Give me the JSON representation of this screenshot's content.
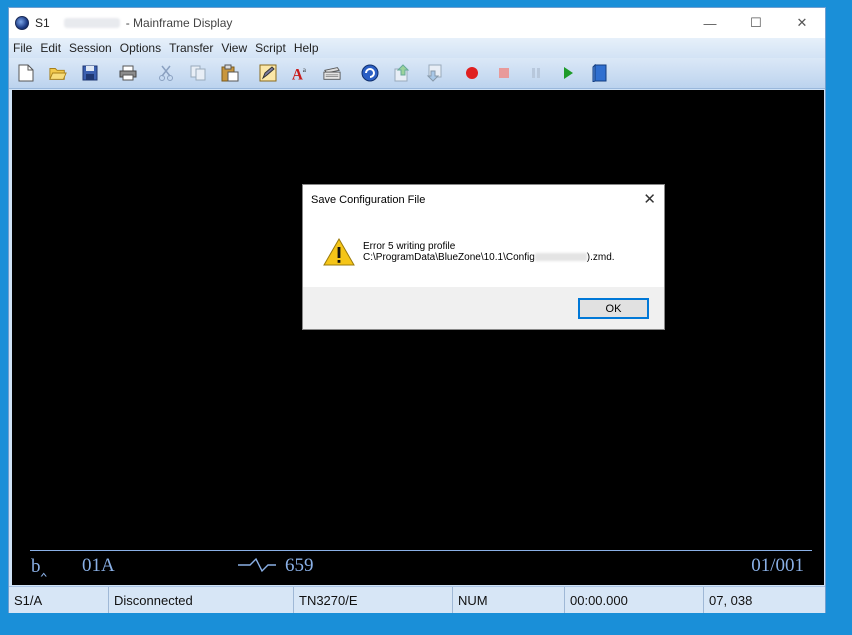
{
  "window": {
    "session": "S1",
    "title": "- Mainframe Display",
    "controls": {
      "minimize": "—",
      "maximize": "☐",
      "close": "✕"
    }
  },
  "menu": {
    "items": [
      "File",
      "Edit",
      "Session",
      "Options",
      "Transfer",
      "View",
      "Script",
      "Help"
    ]
  },
  "toolbar": {
    "icons": [
      "new-icon",
      "open-icon",
      "save-icon",
      "print-icon",
      "cut-icon",
      "copy-icon",
      "paste-icon",
      "edit-icon",
      "font-icon",
      "keyboard-icon",
      "connect-icon",
      "upload-icon",
      "download-icon",
      "record-icon",
      "stop-icon",
      "pause-icon",
      "play-icon",
      "book-icon"
    ]
  },
  "terminal": {
    "oia": {
      "indicator": "b‸",
      "field1": "01A",
      "field2": "659",
      "cursor": "01/001"
    }
  },
  "dialog": {
    "title": "Save Configuration File",
    "message_line1": "Error 5 writing profile",
    "message_line2_prefix": "C:\\ProgramData\\BlueZone\\10.1\\Config",
    "message_line2_suffix": ").zmd.",
    "ok_label": "OK",
    "close_glyph": "✕"
  },
  "statusbar": {
    "session": "S1/A",
    "connection": "Disconnected",
    "terminal_type": "TN3270/E",
    "num": "NUM",
    "timer": "00:00.000",
    "cursor_pos": "07, 038"
  }
}
